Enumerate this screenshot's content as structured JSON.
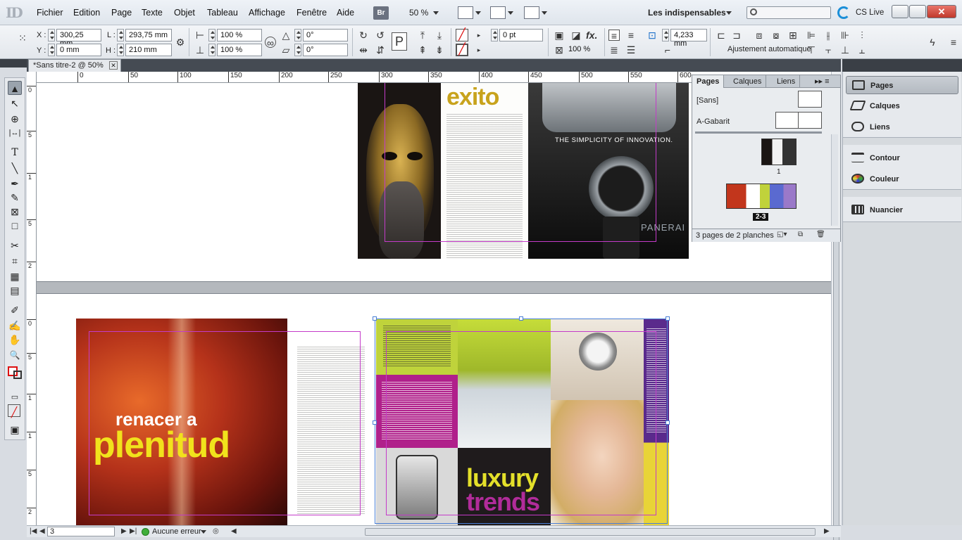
{
  "app": {
    "logo_text": "ID"
  },
  "menu": {
    "items": [
      "Fichier",
      "Edition",
      "Page",
      "Texte",
      "Objet",
      "Tableau",
      "Affichage",
      "Fenêtre",
      "Aide"
    ],
    "bridge_badge": "Br",
    "zoom": "50 %",
    "workspace": "Les indispensables",
    "cs_live": "CS Live",
    "close_glyph": "✕"
  },
  "controlbar": {
    "x_label": "X :",
    "x_value": "300,25 mm",
    "y_label": "Y :",
    "y_value": "0 mm",
    "w_label": "L :",
    "w_value": "293,75 mm",
    "h_label": "H :",
    "h_value": "210 mm",
    "scale_x": "100 %",
    "scale_y": "100 %",
    "rotate": "0°",
    "shear": "0°",
    "stroke_weight": "0 pt",
    "opacity": "100 %",
    "offset": "4,233 mm",
    "autofit_label": "Ajustement automatique",
    "autofit_checked": "✓",
    "fx_label": "fx."
  },
  "tools": [
    "▲",
    "↖",
    "⊕",
    "|↔|",
    "T",
    "╲",
    "✒",
    "✎",
    "⊠",
    "□",
    "✂",
    "⌗",
    "▦",
    "▤",
    "✐",
    "✍",
    "✋",
    "🔍"
  ],
  "document": {
    "tab_title": "*Sans titre-2 @ 50%",
    "tab_close": "✕",
    "ruler_h": [
      "0",
      "50",
      "100",
      "150",
      "200",
      "250",
      "300",
      "350",
      "400",
      "450",
      "500",
      "550",
      "600"
    ],
    "ruler_v": [
      "0",
      "5",
      "1",
      "5",
      "2",
      "0",
      "5",
      "1",
      "1",
      "5",
      "2"
    ]
  },
  "spread1": {
    "title": "exito",
    "ad_headline": "THE SIMPLICITY OF INNOVATION.",
    "brand": "PANERAI"
  },
  "spread2": {
    "headline_small": "renacer a",
    "headline_big": "plenitud",
    "luxury": "luxury",
    "trends": "trends"
  },
  "statusbar": {
    "page_value": "3",
    "preflight": "Aucune erreur"
  },
  "pages_panel": {
    "tabs": [
      "Pages",
      "Calques",
      "Liens"
    ],
    "master_none": "[Sans]",
    "master_a": "A-Gabarit",
    "page1_label": "1",
    "page23_label": "2-3",
    "count": "3 pages de 2 planches"
  },
  "dock": {
    "items": [
      "Pages",
      "Calques",
      "Liens",
      "Contour",
      "Couleur",
      "Nuancier"
    ]
  }
}
